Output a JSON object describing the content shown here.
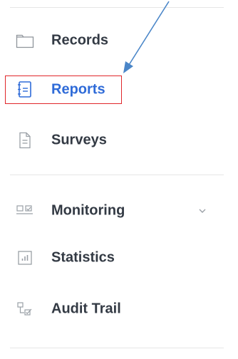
{
  "nav": {
    "items": [
      {
        "key": "records",
        "label": "Records",
        "icon": "folder-icon"
      },
      {
        "key": "reports",
        "label": "Reports",
        "icon": "report-icon"
      },
      {
        "key": "surveys",
        "label": "Surveys",
        "icon": "document-icon"
      },
      {
        "key": "monitoring",
        "label": "Monitoring",
        "icon": "monitoring-icon"
      },
      {
        "key": "statistics",
        "label": "Statistics",
        "icon": "bar-chart-icon"
      },
      {
        "key": "audit",
        "label": "Audit Trail",
        "icon": "audit-trail-icon"
      }
    ],
    "active": "Reports"
  },
  "colors": {
    "active_text": "#2f6bd8",
    "text": "#333a44",
    "highlight_border": "#e0262a",
    "arrow": "#4a86c8",
    "icon_gray": "#9aa0a6"
  }
}
